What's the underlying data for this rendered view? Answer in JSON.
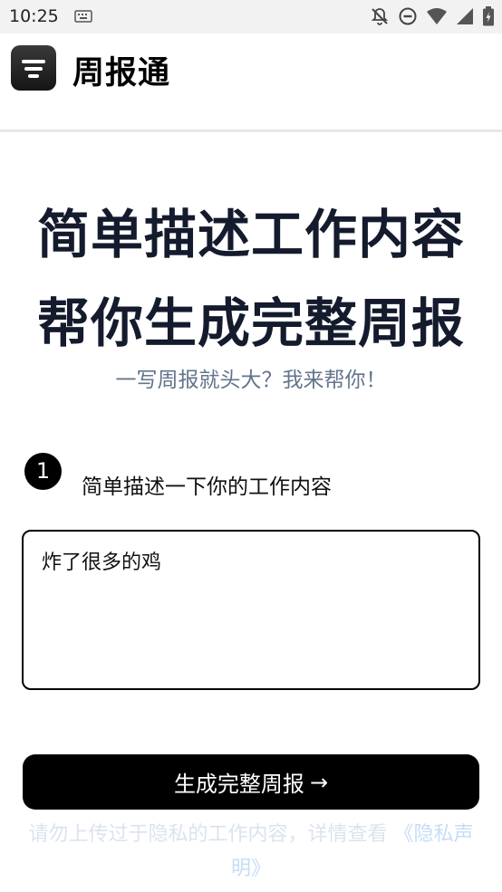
{
  "status_bar": {
    "time": "10:25"
  },
  "header": {
    "title": "周报通"
  },
  "hero": {
    "line1": "简单描述工作内容",
    "line2": "帮你生成完整周报",
    "subtitle": "一写周报就头大？我来帮你！"
  },
  "step": {
    "number": "1",
    "label": "简单描述一下你的工作内容"
  },
  "input": {
    "value": "炸了很多的鸡"
  },
  "actions": {
    "generate_label": "生成完整周报",
    "generate_arrow": "→"
  },
  "privacy": {
    "text": "请勿上传过于隐私的工作内容，详情查看",
    "link": "《隐私声明》"
  },
  "colors": {
    "hero_text": "#141b2d",
    "subtitle": "#64748b",
    "button_bg": "#000000",
    "note": "#dbe3ee"
  }
}
